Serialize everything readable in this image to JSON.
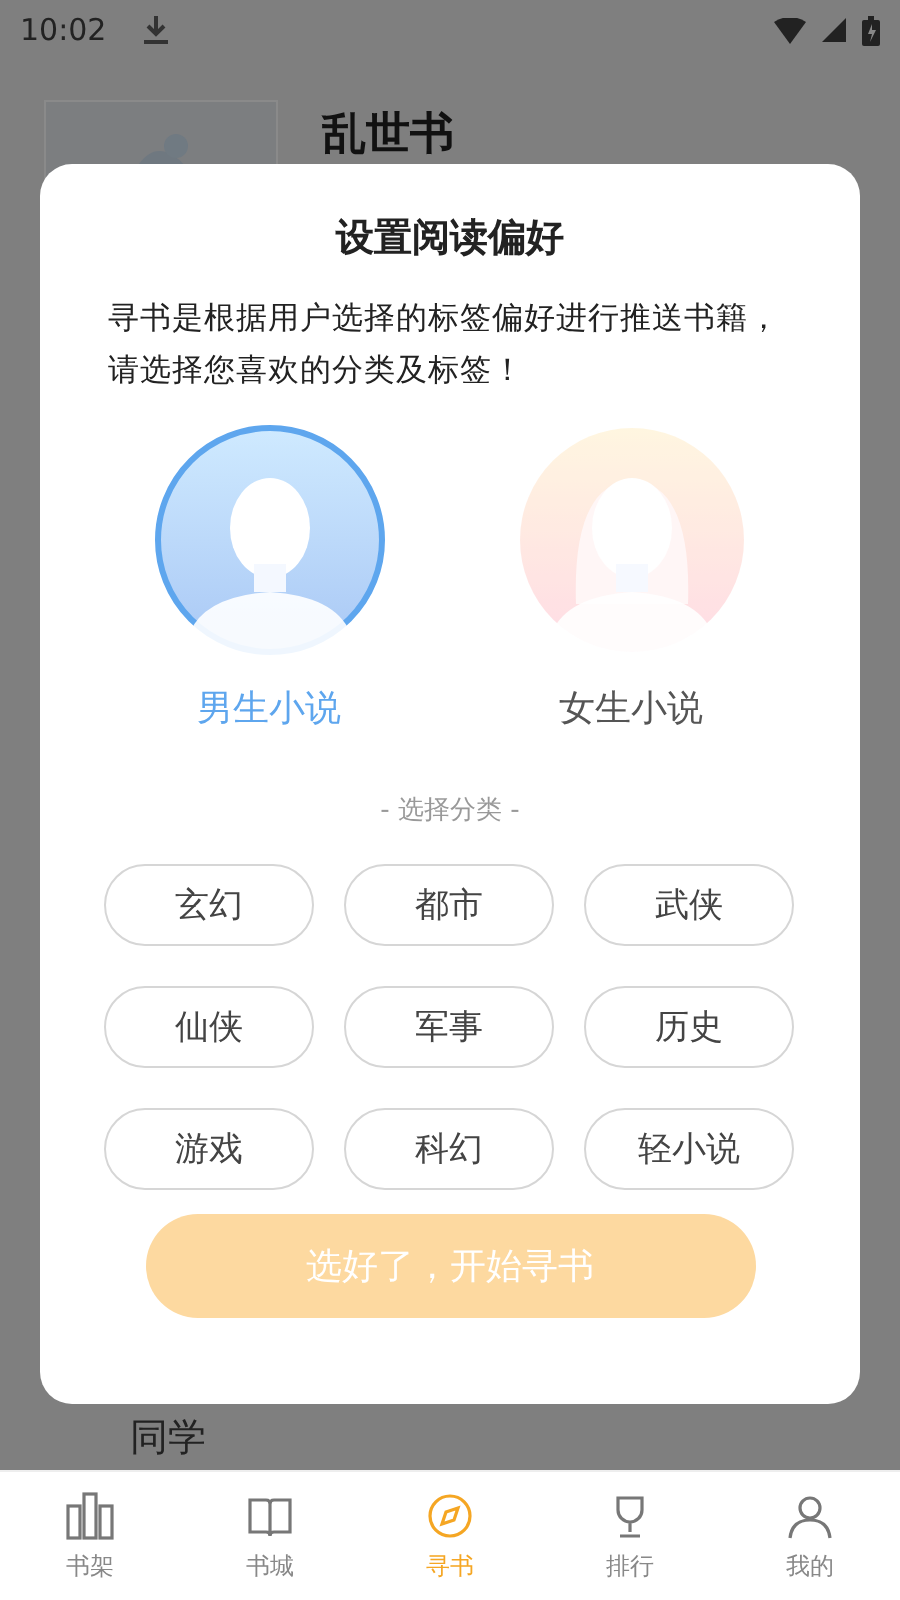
{
  "status_bar": {
    "time": "10:02"
  },
  "background": {
    "book_title": "乱世书",
    "section_title": "同学"
  },
  "dialog": {
    "title": "设置阅读偏好",
    "description": "寻书是根据用户选择的标签偏好进行推送书籍，请选择您喜欢的分类及标签！",
    "genders": [
      {
        "kind": "male",
        "label": "男生小说",
        "selected": true
      },
      {
        "kind": "female",
        "label": "女生小说",
        "selected": false
      }
    ],
    "section_label": "- 选择分类 -",
    "tags": [
      {
        "label": "玄幻",
        "selected": false
      },
      {
        "label": "都市",
        "selected": false
      },
      {
        "label": "武侠",
        "selected": false
      },
      {
        "label": "仙侠",
        "selected": false
      },
      {
        "label": "军事",
        "selected": false
      },
      {
        "label": "历史",
        "selected": false
      },
      {
        "label": "游戏",
        "selected": false
      },
      {
        "label": "科幻",
        "selected": false
      },
      {
        "label": "轻小说",
        "selected": false
      }
    ],
    "confirm_button": "选好了，开始寻书"
  },
  "bottom_nav": [
    {
      "kind": "shelf",
      "label": "书架",
      "selected": false
    },
    {
      "kind": "store",
      "label": "书城",
      "selected": false
    },
    {
      "kind": "find",
      "label": "寻书",
      "selected": true
    },
    {
      "kind": "rank",
      "label": "排行",
      "selected": false
    },
    {
      "kind": "me",
      "label": "我的",
      "selected": false
    }
  ]
}
